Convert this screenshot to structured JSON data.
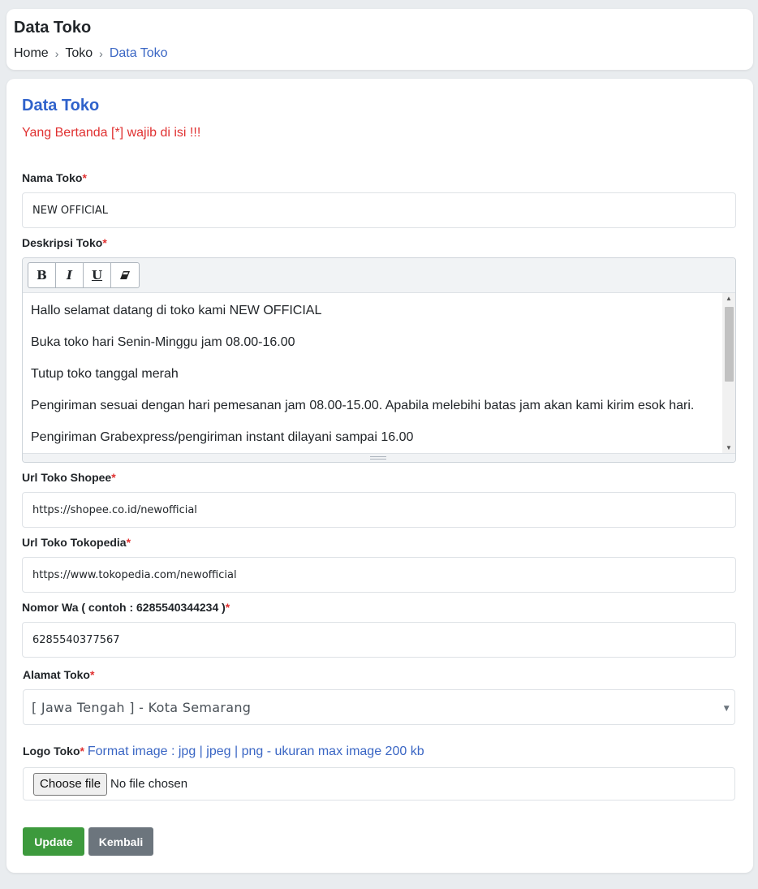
{
  "header": {
    "title": "Data Toko",
    "breadcrumb": [
      "Home",
      "Toko",
      "Data Toko"
    ],
    "breadcrumb_separator": "›"
  },
  "form": {
    "title": "Data Toko",
    "note": "Yang Bertanda [*] wajib di isi !!!",
    "required_mark": "*",
    "nama_toko": {
      "label": "Nama Toko",
      "value": "NEW OFFICIAL"
    },
    "deskripsi": {
      "label": "Deskripsi Toko",
      "toolbar": {
        "bold": "B",
        "italic": "I",
        "underline": "U",
        "eraser_icon": "eraser-icon"
      },
      "paragraphs": [
        "Hallo selamat datang di toko kami NEW OFFICIAL",
        "Buka toko hari Senin-Minggu jam 08.00-16.00",
        "Tutup toko tanggal merah",
        "Pengiriman sesuai dengan hari pemesanan jam 08.00-15.00. Apabila melebihi batas jam akan kami kirim esok hari.",
        "Pengiriman Grabexpress/pengiriman instant dilayani sampai 16.00"
      ]
    },
    "url_shopee": {
      "label": "Url Toko Shopee",
      "value": "https://shopee.co.id/newofficial"
    },
    "url_tokopedia": {
      "label": "Url Toko Tokopedia",
      "value": "https://www.tokopedia.com/newofficial"
    },
    "nomor_wa": {
      "label": "Nomor Wa ( contoh : 6285540344234 )",
      "value": "6285540377567"
    },
    "alamat": {
      "label": "Alamat Toko",
      "selected": "[ Jawa Tengah ] - Kota Semarang"
    },
    "logo": {
      "label": "Logo Toko",
      "hint": "Format image : jpg | jpeg | png - ukuran max image 200 kb",
      "button": "Choose file",
      "status": "No file chosen"
    },
    "buttons": {
      "update": "Update",
      "back": "Kembali"
    }
  },
  "colors": {
    "background": "#e9ecef",
    "accent_blue": "#2f62cb",
    "required_red": "#e03131",
    "update_green": "#3d9a3d",
    "back_gray": "#6c757d"
  }
}
